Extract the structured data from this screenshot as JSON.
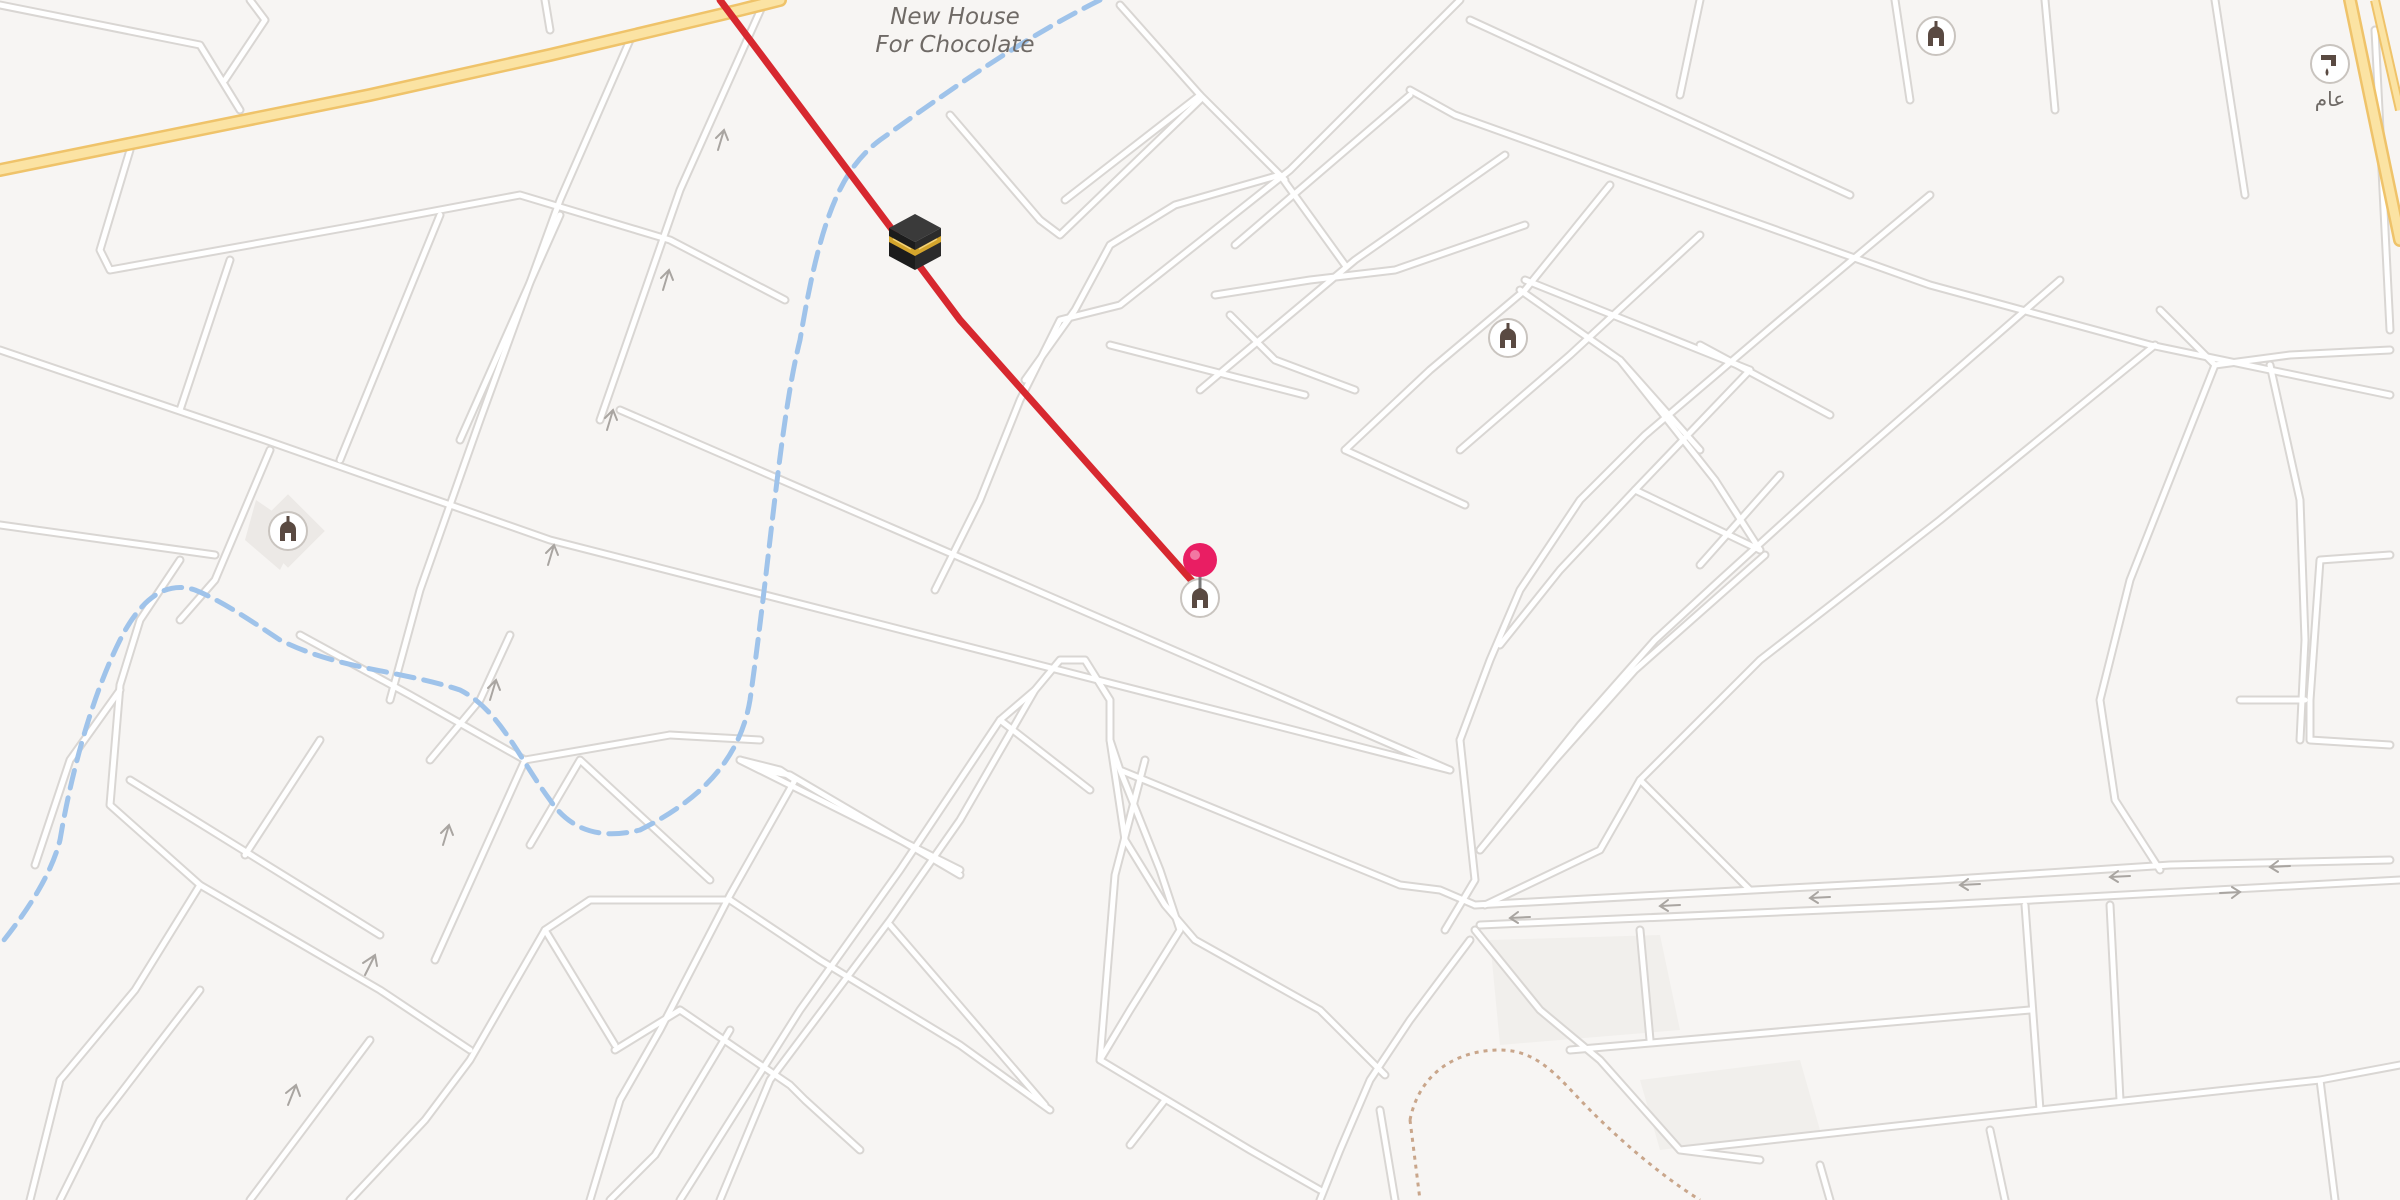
{
  "map": {
    "labels": {
      "place_line1": "New House",
      "place_line2": "For Chocolate",
      "poi_arabic": "عام"
    },
    "colors": {
      "background": "#f7f5f3",
      "road": "#ffffff",
      "road_casing": "#d9d6d3",
      "highway": "#fbe3a3",
      "highway_casing": "#efc36a",
      "route_line": "#d7282f",
      "dashed_path": "#9fc3ea",
      "pin": "#e91e63",
      "trail": "#c9a68b"
    },
    "icons": {
      "kaaba": "kaaba-icon",
      "pin": "map-pin-icon",
      "mosque": "mosque-icon",
      "water_tap": "water-tap-icon"
    }
  }
}
